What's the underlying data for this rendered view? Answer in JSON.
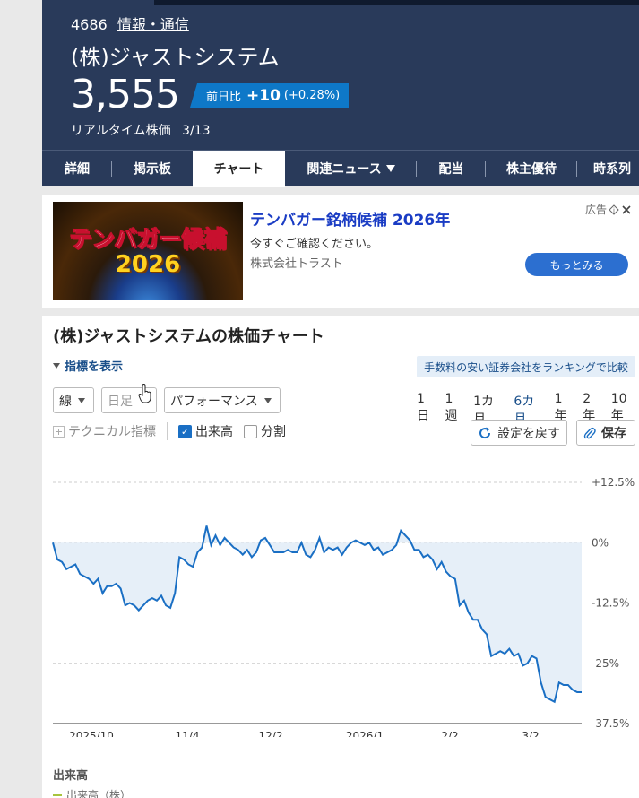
{
  "header": {
    "code": "4686",
    "category": "情報・通信",
    "company": "(株)ジャストシステム",
    "price": "3,555",
    "change_label": "前日比",
    "change_value": "+10",
    "change_pct": "(+0.28%)",
    "realtime_label": "リアルタイム株価",
    "date": "3/13"
  },
  "nav": {
    "items": [
      {
        "label": "詳細"
      },
      {
        "label": "掲示板"
      },
      {
        "label": "チャート"
      },
      {
        "label": "関連ニュース"
      },
      {
        "label": "配当"
      },
      {
        "label": "株主優待"
      },
      {
        "label": "時系列"
      }
    ],
    "active": "チャート"
  },
  "ad": {
    "image_line1": "テンバガー候補",
    "image_line2": "2026",
    "title": "テンバガー銘柄候補 2026年",
    "subtitle": "今すぐご確認ください。",
    "sponsor": "株式会社トラスト",
    "label": "広告",
    "cta": "もっとみる"
  },
  "chart_section": {
    "title": "(株)ジャストシステムの株価チャート",
    "indicator_toggle": "指標を表示",
    "broker_link": "手数料の安い証券会社をランキングで比較",
    "line_select": "線",
    "period_select": "日足",
    "mode_select": "パフォーマンス",
    "periods": [
      "1日",
      "1週",
      "1カ月",
      "6カ月",
      "1年",
      "2年",
      "10年"
    ],
    "active_period": "6カ月",
    "technical": "テクニカル指標",
    "volume_check": "出来高",
    "split_check": "分割",
    "reset_button": "設定を戻す",
    "save_button": "保存",
    "volume_title": "出来高",
    "volume_legend": "出来高（株）"
  },
  "colors": {
    "header_bg": "#293a5a",
    "accent": "#0e78c8",
    "line": "#1a6fc4",
    "area": "#e6eff8"
  },
  "chart_data": {
    "type": "area",
    "x_ticks": [
      "2025/10",
      "11/4",
      "12/2",
      "2026/1",
      "2/2",
      "3/2"
    ],
    "y_ticks": [
      "+12.5%",
      "0%",
      "-12.5%",
      "-25%",
      "-37.5%"
    ],
    "ylim": [
      -37.5,
      12.5
    ],
    "grid": true,
    "series": [
      {
        "values": [
          0,
          -3.5,
          -4,
          -5.5,
          -5,
          -4.5,
          -6.5,
          -7,
          -7.5,
          -8.5,
          -7.5,
          -10.5,
          -9,
          -9,
          -8.5,
          -9.5,
          -13,
          -12.5,
          -13,
          -14,
          -13,
          -12,
          -11.5,
          -12,
          -11,
          -13,
          -13.5,
          -10.5,
          -3,
          -3.5,
          -4.5,
          -5,
          -2,
          -1,
          3.5,
          -0.5,
          1.5,
          -0.5,
          1,
          0,
          -1,
          -1.5,
          -2.5,
          -1.5,
          -3,
          -2,
          0.5,
          1,
          -0.5,
          -2,
          -2,
          -2,
          -1.5,
          -2,
          -2,
          0,
          -2.5,
          -3,
          -1.5,
          1,
          -2,
          -1,
          -1.5,
          -1,
          -2.5,
          -1,
          0,
          0.5,
          0,
          -0.5,
          0,
          -1.5,
          -1,
          -2.5,
          -2,
          -1.5,
          -0.5,
          2.5,
          1.5,
          0.5,
          -1.5,
          -1.5,
          -3,
          -2.5,
          -3.5,
          -5.5,
          -4,
          -6,
          -7,
          -7.5,
          -13,
          -12,
          -14.5,
          -16,
          -16,
          -18,
          -19,
          -23.5,
          -23,
          -22.5,
          -23,
          -22,
          -23.5,
          -23,
          -25.5,
          -25,
          -23.5,
          -24,
          -29,
          -32,
          -32.5,
          -33,
          -29,
          -29.5,
          -29.5,
          -30.5,
          -31,
          -31
        ]
      }
    ]
  }
}
